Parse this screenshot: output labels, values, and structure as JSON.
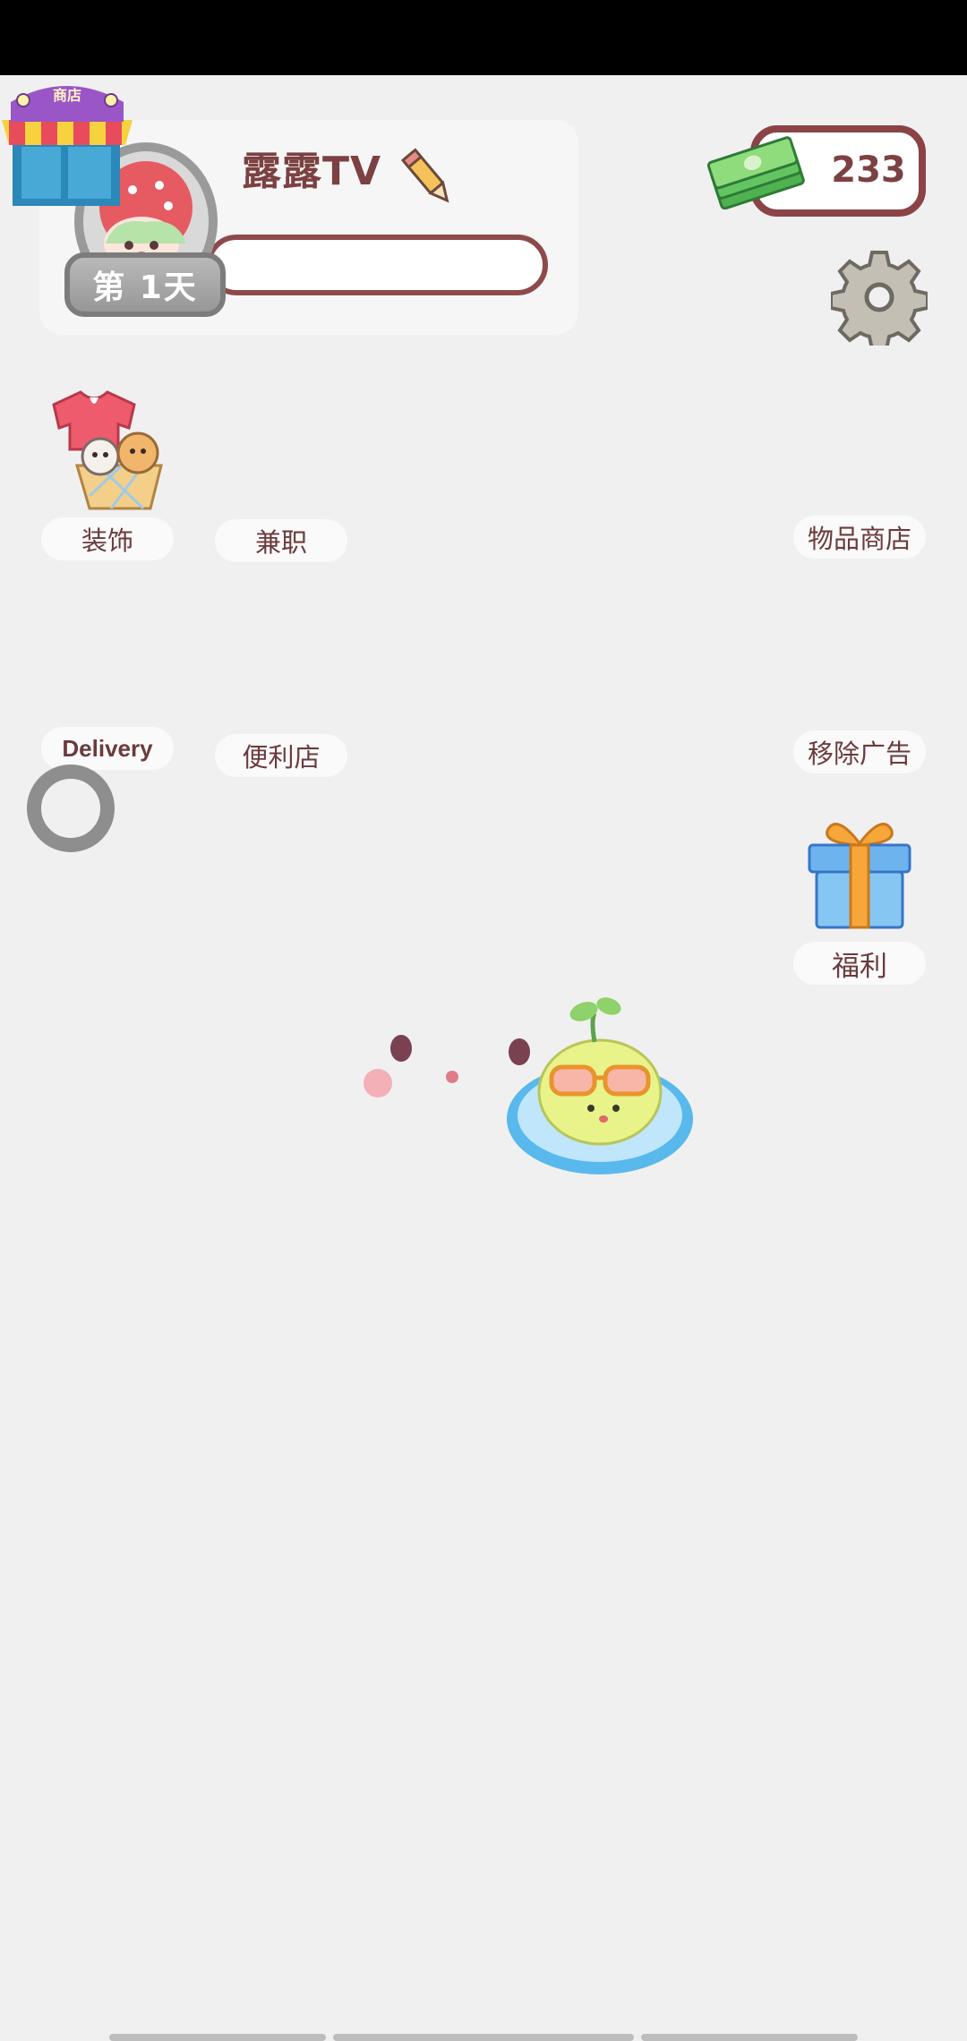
{
  "profile": {
    "name": "露露TV",
    "day_badge": "第 1天"
  },
  "shop": {
    "sign": "商店"
  },
  "money": {
    "amount": "233"
  },
  "menu": {
    "decor": "装饰",
    "part_time": "兼职",
    "item_shop": "物品商店",
    "delivery": "Delivery",
    "convenience_store": "便利店",
    "remove_ads": "移除广告",
    "welfare": "福利"
  },
  "icons": {
    "shop": "shop-icon",
    "money": "cash-stack-icon",
    "settings": "gear-icon",
    "edit": "pencil-icon",
    "gift": "gift-icon"
  },
  "colors": {
    "accent": "#7c4142",
    "background": "#f1f0f1"
  }
}
